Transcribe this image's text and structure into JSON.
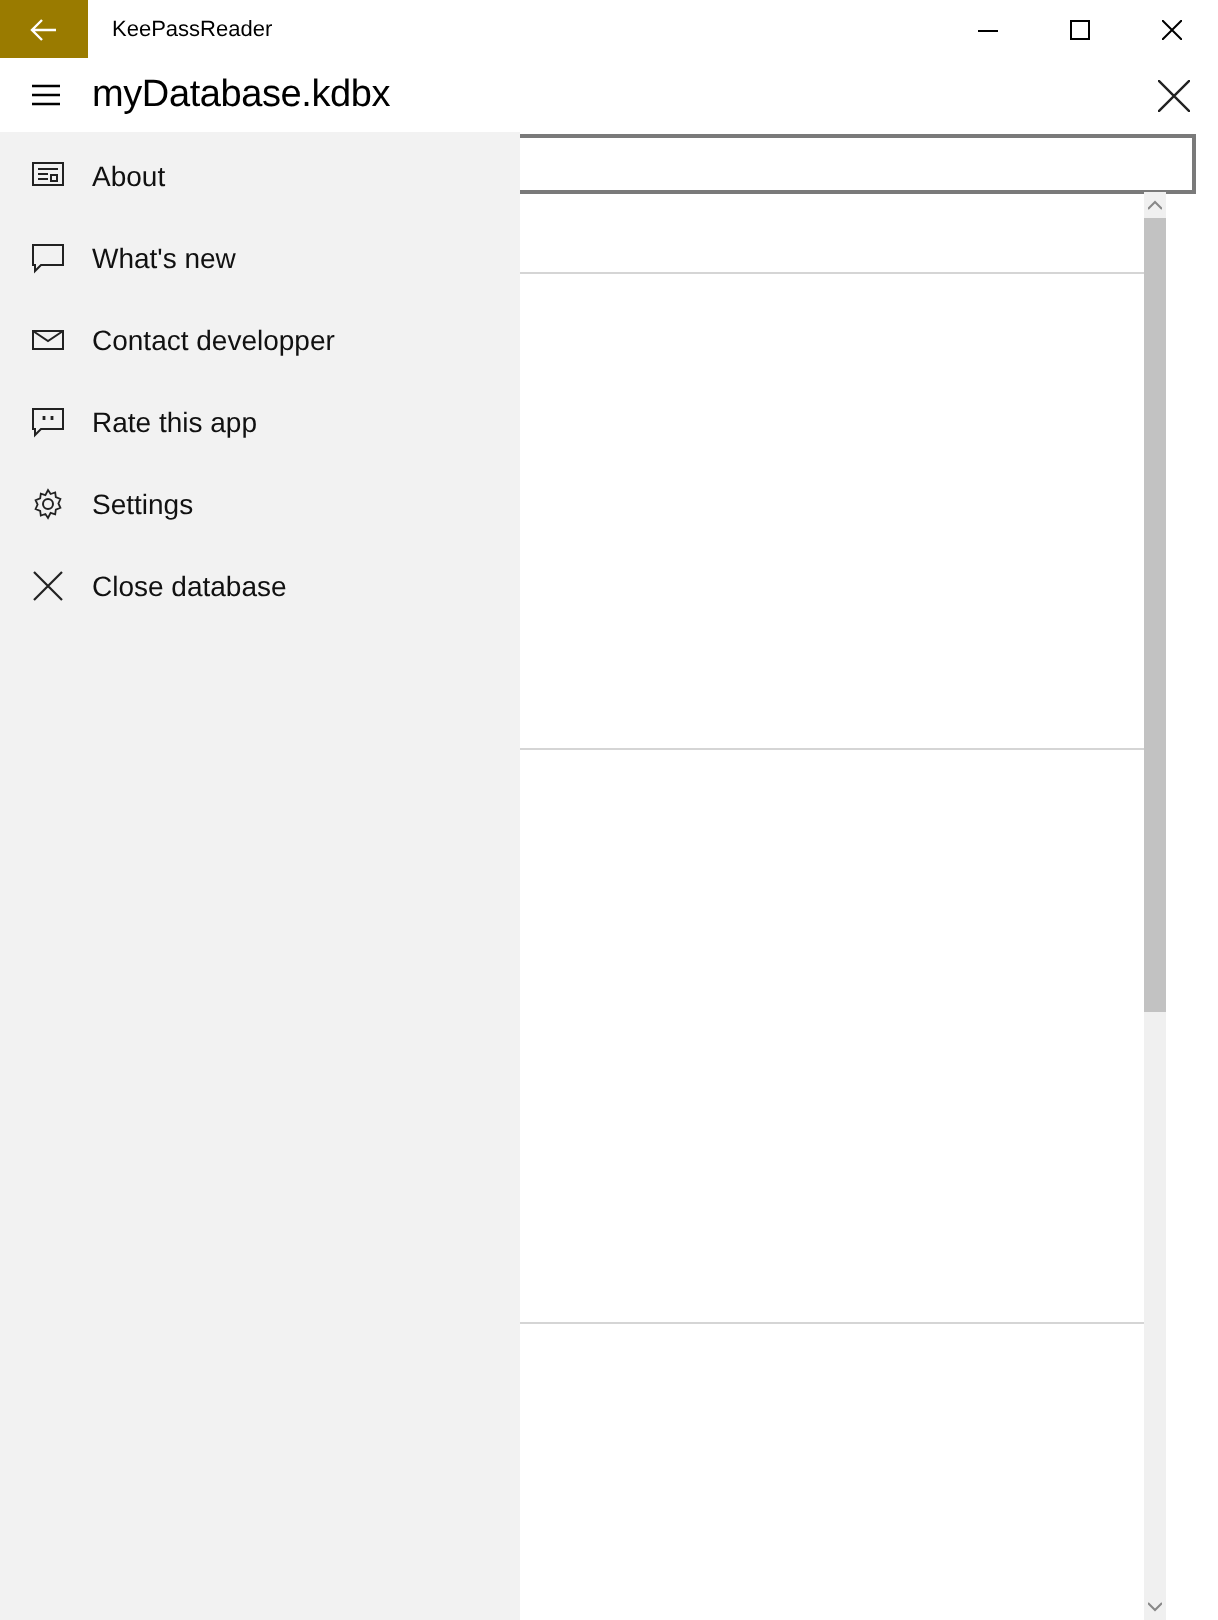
{
  "window": {
    "title": "KeePassReader"
  },
  "header": {
    "title": "myDatabase.kdbx"
  },
  "menu": {
    "items": [
      {
        "label": "About",
        "kind": "about"
      },
      {
        "label": "What's new",
        "kind": "news"
      },
      {
        "label": "Contact developper",
        "kind": "mail"
      },
      {
        "label": "Rate this app",
        "kind": "rate"
      },
      {
        "label": "Settings",
        "kind": "settings"
      },
      {
        "label": "Close database",
        "kind": "close"
      }
    ]
  }
}
